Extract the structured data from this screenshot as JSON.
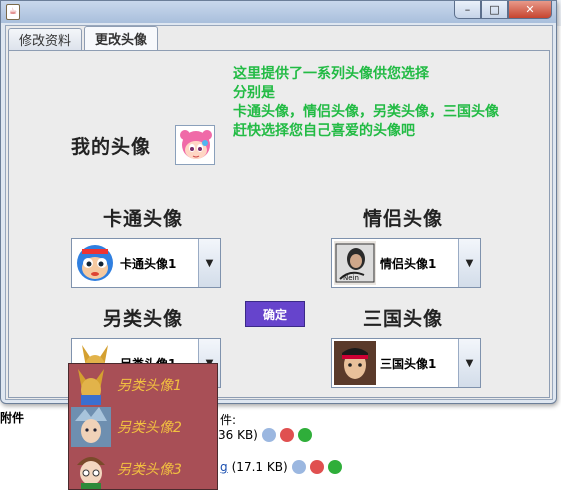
{
  "background": {
    "attach_label": "附件",
    "attach_label2": "件:",
    "row1_size": "36 KB)",
    "row2_name": "g",
    "row2_size": "(17.1 KB)"
  },
  "window": {
    "close_glyph": "✕",
    "maximize_glyph": "□",
    "minimize_glyph": "–",
    "java_glyph": "☕"
  },
  "tabs": [
    {
      "label": "修改资料"
    },
    {
      "label": "更改头像"
    }
  ],
  "panel": {
    "my_avatar_label": "我的头像",
    "info_lines": [
      "这里提供了一系列头像供您选择",
      "分别是",
      "卡通头像，情侣头像，另类头像，三国头像",
      "赶快选择您自己喜爱的头像吧"
    ],
    "cartoon": {
      "heading": "卡通头像",
      "selected": "卡通头像1"
    },
    "couple": {
      "heading": "情侣头像",
      "selected": "情侣头像1"
    },
    "alt": {
      "heading": "另类头像",
      "selected": "另类头像1"
    },
    "three_kingdoms": {
      "heading": "三国头像",
      "selected": "三国头像1"
    },
    "ok_label": "确定",
    "arrow_glyph": "▼"
  },
  "dropdown_options": [
    "另类头像1",
    "另类头像2",
    "另类头像3"
  ],
  "colors": {
    "info_text": "#22bb44",
    "ok_button": "#6644cc",
    "dropdown_bg": "#a84f56",
    "dropdown_text": "#f2c040"
  }
}
